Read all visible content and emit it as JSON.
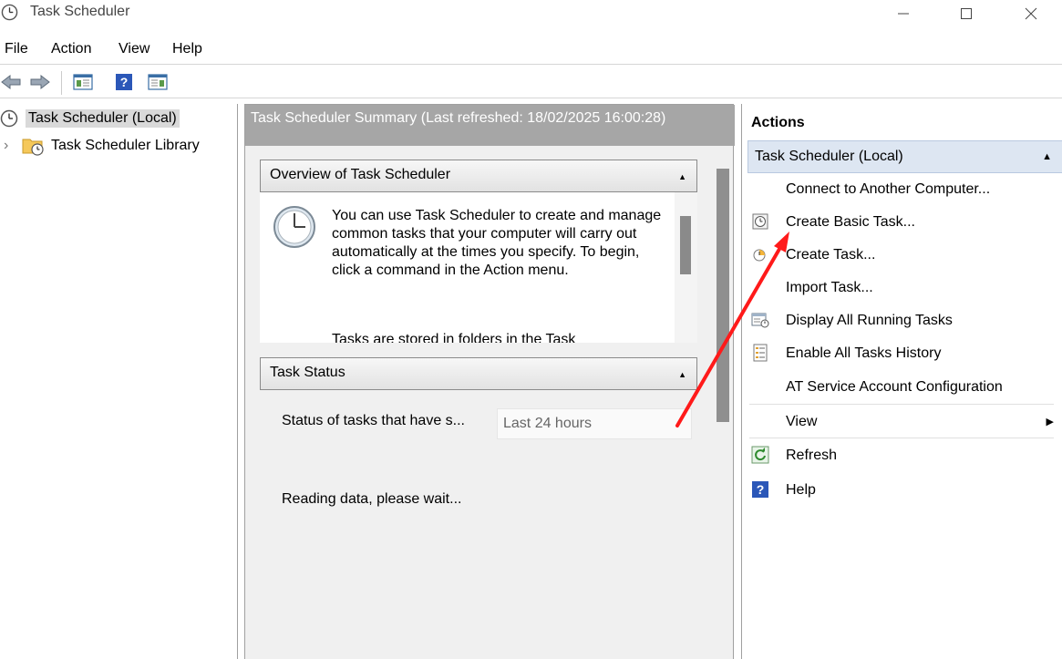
{
  "window": {
    "title": "Task Scheduler",
    "controls": {
      "minimize": "—",
      "maximize": "☐",
      "close": "✕"
    }
  },
  "menu": [
    "File",
    "Action",
    "View",
    "Help"
  ],
  "toolbar": {
    "buttons": [
      "back-arrow-icon",
      "forward-arrow-icon",
      "show-hide-console-tree-icon",
      "help-icon",
      "show-hide-action-pane-icon"
    ]
  },
  "tree": {
    "root": {
      "label": "Task Scheduler (Local)",
      "icon": "clock-icon"
    },
    "child": {
      "label": "Task Scheduler Library",
      "icon": "folder-clock-icon",
      "expander": "›"
    }
  },
  "center": {
    "header": "Task Scheduler Summary (Last refreshed: 18/02/2025 16:00:28)",
    "overview": {
      "title": "Overview of Task Scheduler",
      "collapse": "▲",
      "text": "You can use Task Scheduler to create and manage common tasks that your computer will carry out automatically at the times you specify. To begin, click a command in the Action menu.",
      "text2": "Tasks are stored in folders in the Task"
    },
    "status": {
      "title": "Task Status",
      "collapse": "▲",
      "label": "Status of tasks that have s...",
      "select_value": "Last 24 hours",
      "reading": "Reading data, please wait..."
    }
  },
  "actions": {
    "title": "Actions",
    "group": {
      "label": "Task Scheduler (Local)",
      "arrow": "▲"
    },
    "items": [
      {
        "label": "Connect to Another Computer...",
        "icon": ""
      },
      {
        "label": "Create Basic Task...",
        "icon": "basic-task-icon"
      },
      {
        "label": "Create Task...",
        "icon": "create-task-icon"
      },
      {
        "label": "Import Task...",
        "icon": ""
      },
      {
        "label": "Display All Running Tasks",
        "icon": "running-tasks-icon"
      },
      {
        "label": "Enable All Tasks History",
        "icon": "history-icon"
      },
      {
        "label": "AT Service Account Configuration",
        "icon": ""
      },
      {
        "label": "View",
        "icon": "",
        "submenu": "▶"
      },
      {
        "label": "Refresh",
        "icon": "refresh-icon"
      },
      {
        "label": "Help",
        "icon": "help-icon"
      }
    ]
  },
  "colors": {
    "annotation_arrow": "#ff1a1a",
    "summary_header_bg": "#a6a6a6",
    "actions_group_bg": "#dde6f2"
  }
}
